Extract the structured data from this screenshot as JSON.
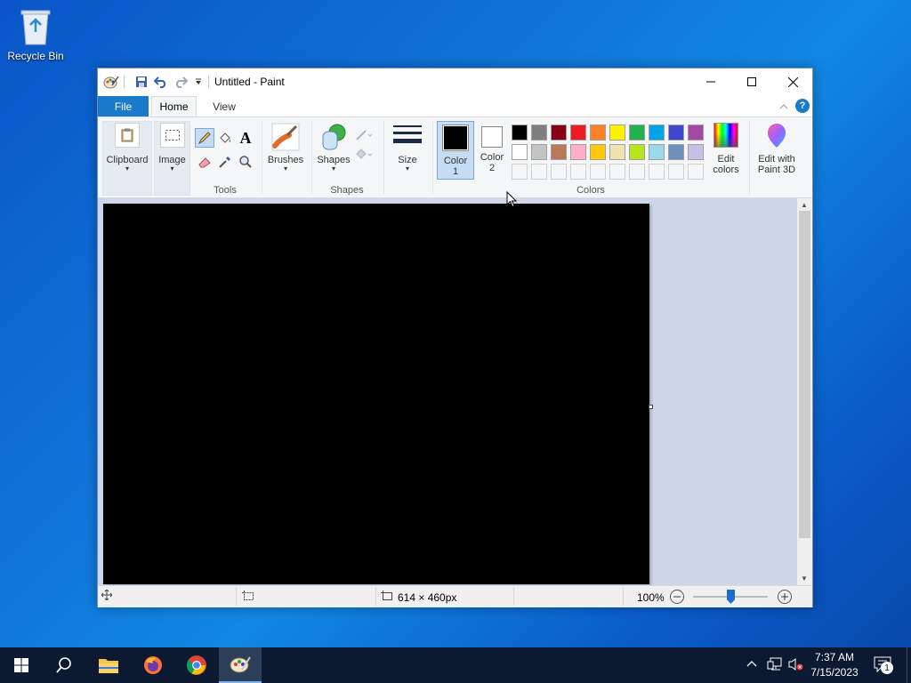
{
  "desktop": {
    "recycle_bin_label": "Recycle Bin"
  },
  "window": {
    "title": "Untitled - Paint"
  },
  "tabs": {
    "file": "File",
    "home": "Home",
    "view": "View"
  },
  "ribbon": {
    "clipboard": "Clipboard",
    "image": "Image",
    "tools_group": "Tools",
    "brushes": "Brushes",
    "shapes": "Shapes",
    "shapes_group": "Shapes",
    "size": "Size",
    "color1_line1": "Color",
    "color1_line2": "1",
    "color2_line1": "Color",
    "color2_line2": "2",
    "colors_group": "Colors",
    "edit_colors_line1": "Edit",
    "edit_colors_line2": "colors",
    "paint3d_line1": "Edit with",
    "paint3d_line2": "Paint 3D"
  },
  "palette": {
    "row1": [
      "#000000",
      "#7f7f7f",
      "#880015",
      "#ed1c24",
      "#ff7f27",
      "#fff200",
      "#22b14c",
      "#00a2e8",
      "#3f48cc",
      "#a349a4"
    ],
    "row2": [
      "#ffffff",
      "#c3c3c3",
      "#b97a57",
      "#ffaec9",
      "#ffc90e",
      "#efe4b0",
      "#b5e61d",
      "#99d9ea",
      "#7092be",
      "#c8bfe7"
    ],
    "color1": "#000000",
    "color2": "#ffffff"
  },
  "status": {
    "size": "614 × 460px",
    "zoom": "100%",
    "zoom_level": 0.5
  },
  "taskbar": {
    "time": "7:37 AM",
    "date": "7/15/2023",
    "notification_count": "1"
  }
}
